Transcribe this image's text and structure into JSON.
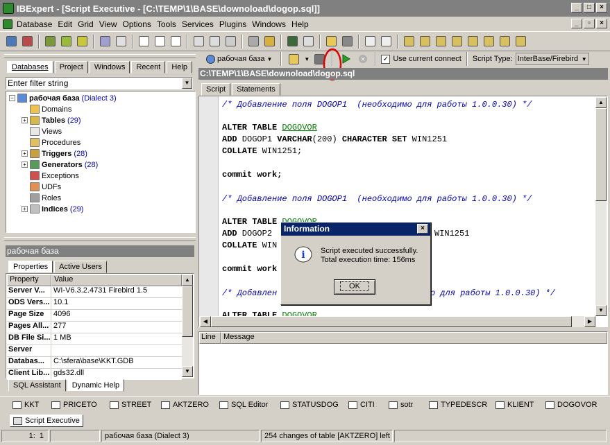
{
  "window": {
    "title": "IBExpert - [Script Executive - [C:\\TEMP\\1\\BASE\\downoload\\dogop.sql]]"
  },
  "menu": [
    "Database",
    "Edit",
    "Grid",
    "View",
    "Options",
    "Tools",
    "Services",
    "Plugins",
    "Windows",
    "Help"
  ],
  "left_panel": {
    "tabs": [
      "Databases",
      "Project",
      "Windows",
      "Recent",
      "Help"
    ],
    "filter_placeholder": "Enter filter string",
    "db_name": "рабочая база",
    "db_dialect": "(Dialect 3)",
    "tree": [
      {
        "label": "Domains",
        "count": "",
        "bold": false,
        "expandable": false
      },
      {
        "label": "Tables",
        "count": "(29)",
        "bold": true,
        "expandable": true
      },
      {
        "label": "Views",
        "count": "",
        "bold": false,
        "expandable": false
      },
      {
        "label": "Procedures",
        "count": "",
        "bold": false,
        "expandable": false
      },
      {
        "label": "Triggers",
        "count": "(28)",
        "bold": true,
        "expandable": true
      },
      {
        "label": "Generators",
        "count": "(28)",
        "bold": true,
        "expandable": true
      },
      {
        "label": "Exceptions",
        "count": "",
        "bold": false,
        "expandable": false
      },
      {
        "label": "UDFs",
        "count": "",
        "bold": false,
        "expandable": false
      },
      {
        "label": "Roles",
        "count": "",
        "bold": false,
        "expandable": false
      },
      {
        "label": "Indices",
        "count": "(29)",
        "bold": true,
        "expandable": true
      }
    ]
  },
  "props_panel": {
    "title": "рабочая база",
    "tabs": [
      "Properties",
      "Active Users"
    ],
    "headers": [
      "Property",
      "Value"
    ],
    "rows": [
      {
        "k": "Server V...",
        "v": "WI-V6.3.2.4731 Firebird 1.5"
      },
      {
        "k": "ODS Vers...",
        "v": "10.1"
      },
      {
        "k": "Page Size",
        "v": "4096"
      },
      {
        "k": "Pages All...",
        "v": "277"
      },
      {
        "k": "DB File Si...",
        "v": "1 MB"
      },
      {
        "k": "Server",
        "v": ""
      },
      {
        "k": "Databas...",
        "v": "C:\\sfera\\base\\KKT.GDB"
      },
      {
        "k": "Client Lib...",
        "v": "gds32.dll"
      }
    ],
    "bottom_tabs": [
      "SQL Assistant",
      "Dynamic Help"
    ]
  },
  "script_toolbar": {
    "db_select": "рабочая база",
    "use_current_label": "Use current connect",
    "use_current_checked": true,
    "script_type_label": "Script Type:",
    "script_type_value": "InterBase/Firebird"
  },
  "file_path": "C:\\TEMP\\1\\BASE\\downoload\\dogop.sql",
  "editor_tabs": [
    "Script",
    "Statements"
  ],
  "code": {
    "c1": "/* Добавление поля DOGOP1  (необходимо для работы 1.0.0.30) */",
    "l1a": "ALTER TABLE",
    "t1": "DOGOVOR",
    "l2a": "ADD",
    "l2b": " DOGOP1 ",
    "l2c": "VARCHAR",
    "l2d": "(200) ",
    "l2e": "CHARACTER SET",
    "l2f": " WIN1251",
    "l3a": "COLLATE",
    "l3b": " WIN1251;",
    "commit": "commit work;",
    "c2": "/* Добавление поля DOGOP1  (необходимо для работы 1.0.0.30) */",
    "l4a": "ALTER TABLE",
    "t2": "DOGOVOR",
    "l5a": "ADD",
    "l5b": " DOGOP2",
    "l5c": "WIN1251",
    "l6a": "COLLATE",
    "l6b": " WIN",
    "commit2": "commit work",
    "c3a": "/* Добавлен",
    "c3b": "о для работы 1.0.0.30) */",
    "l7a": "ALTER TABLE",
    "t3": "DOGOVOR"
  },
  "message_headers": [
    "Line",
    "Message"
  ],
  "dialog": {
    "title": "Information",
    "line1": "Script executed successfully.",
    "line2": "Total execution time: 156ms",
    "ok": "OK"
  },
  "task_tabs": [
    "KKT",
    "PRICETO",
    "STREET",
    "AKTZERO",
    "SQL Editor",
    "STATUSDOG",
    "CITI",
    "sotr",
    "TYPEDESCR",
    "KLIENT",
    "DOGOVOR"
  ],
  "active_window": "Script Executive",
  "status": {
    "pos_line": "1",
    "pos_col": "1",
    "db": "рабочая база (Dialect 3)",
    "msg": "254 changes of table [AKTZERO] left"
  }
}
